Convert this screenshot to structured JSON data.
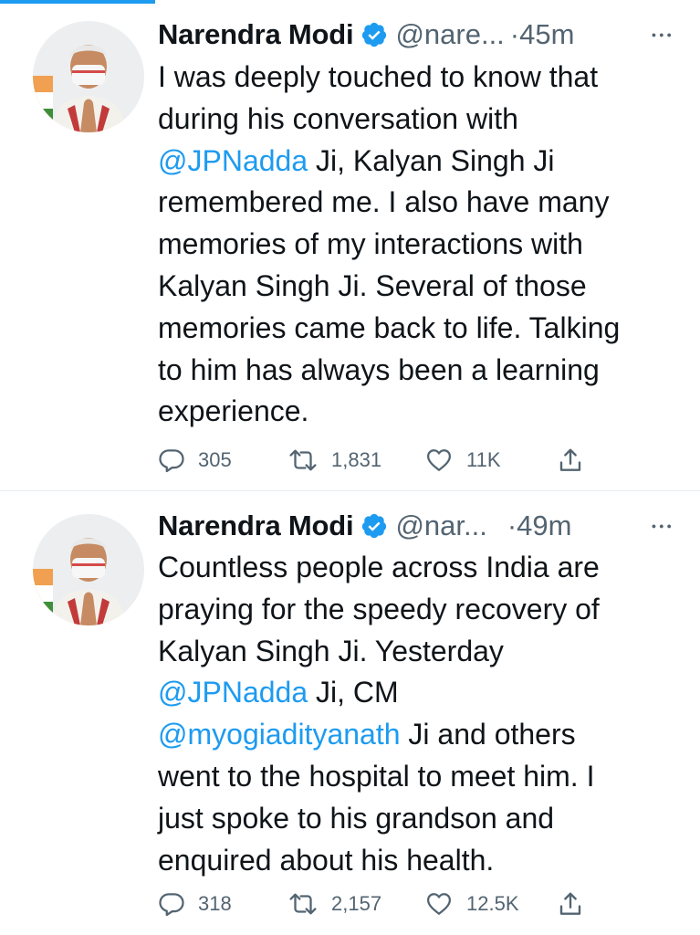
{
  "theme": {
    "accent": "#1d9bf0",
    "text": "#0f1419",
    "muted": "#536471",
    "divider": "#e6ecf0"
  },
  "tweets": [
    {
      "author": {
        "name": "Narendra Modi",
        "handle": "@nare...",
        "verified": true,
        "avatar_icon": "profile-photo"
      },
      "separator": "·",
      "time": "45m",
      "more_icon": "more-options-icon",
      "lines": [
        [
          {
            "text": "I was deeply touched to know that"
          }
        ],
        [
          {
            "text": "during his conversation with"
          }
        ],
        [
          {
            "text": "@JPNadda",
            "mention": true
          },
          {
            "text": " Ji, Kalyan Singh Ji"
          }
        ],
        [
          {
            "text": "remembered me. I also have many"
          }
        ],
        [
          {
            "text": "memories of my interactions with"
          }
        ],
        [
          {
            "text": "Kalyan Singh Ji. Several of those"
          }
        ],
        [
          {
            "text": "memories came back to life. Talking"
          }
        ],
        [
          {
            "text": "to him has always been a learning"
          }
        ],
        [
          {
            "text": "experience."
          }
        ]
      ],
      "stats": {
        "replies": "305",
        "retweets": "1,831",
        "likes": "11K"
      }
    },
    {
      "author": {
        "name": "Narendra Modi",
        "handle": "@nar...",
        "verified": true,
        "avatar_icon": "profile-photo"
      },
      "separator": "·",
      "time": "49m",
      "more_icon": "more-options-icon",
      "lines": [
        [
          {
            "text": "Countless people across India are"
          }
        ],
        [
          {
            "text": "praying for the speedy recovery of"
          }
        ],
        [
          {
            "text": "Kalyan Singh Ji. Yesterday"
          }
        ],
        [
          {
            "text": "@JPNadda",
            "mention": true
          },
          {
            "text": " Ji, CM"
          }
        ],
        [
          {
            "text": "@myogiadityanath",
            "mention": true
          },
          {
            "text": " Ji and others"
          }
        ],
        [
          {
            "text": "went to the hospital to meet him. I"
          }
        ],
        [
          {
            "text": "just spoke to his grandson and"
          }
        ],
        [
          {
            "text": "enquired about his health."
          }
        ]
      ],
      "stats": {
        "replies": "318",
        "retweets": "2,157",
        "likes": "12.5K"
      }
    }
  ]
}
